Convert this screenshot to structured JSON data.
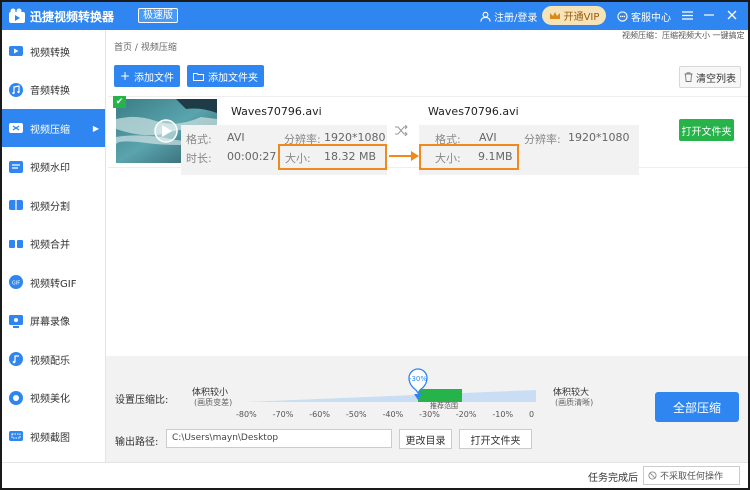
{
  "app": {
    "title": "迅捷视频转换器",
    "edition": "极速版",
    "login": "注册/登录",
    "vip": "开通VIP",
    "service": "客服中心",
    "accent": "#2f86f0"
  },
  "sidebar": {
    "items": [
      {
        "label": "视频转换",
        "icon": "video-convert-icon"
      },
      {
        "label": "音频转换",
        "icon": "audio-convert-icon"
      },
      {
        "label": "视频压缩",
        "icon": "video-compress-icon",
        "active": true
      },
      {
        "label": "视频水印",
        "icon": "watermark-icon"
      },
      {
        "label": "视频分割",
        "icon": "split-icon"
      },
      {
        "label": "视频合并",
        "icon": "merge-icon"
      },
      {
        "label": "视频转GIF",
        "icon": "gif-icon"
      },
      {
        "label": "屏幕录像",
        "icon": "screen-record-icon"
      },
      {
        "label": "视频配乐",
        "icon": "music-icon"
      },
      {
        "label": "视频美化",
        "icon": "beautify-icon"
      },
      {
        "label": "视频截图",
        "icon": "screenshot-icon"
      }
    ]
  },
  "breadcrumb": {
    "home": "首页",
    "sep": "/",
    "current": "视频压缩"
  },
  "hint": "视频压缩：压缩视频大小 一键搞定",
  "toolbar": {
    "add_file": "添加文件",
    "add_folder": "添加文件夹",
    "clear_list": "清空列表"
  },
  "file": {
    "source": {
      "name": "Waves70796.avi",
      "format_label": "格式:",
      "format": "AVI",
      "res_label": "分辨率:",
      "resolution": "1920*1080",
      "dur_label": "时长:",
      "duration": "00:00:27",
      "size_label": "大小:",
      "size": "18.32 MB"
    },
    "target": {
      "name": "Waves70796.avi",
      "format_label": "格式:",
      "format": "AVI",
      "res_label": "分辨率:",
      "resolution": "1920*1080",
      "size_label": "大小:",
      "size": "9.1MB"
    },
    "open_folder": "打开文件夹"
  },
  "compression": {
    "label": "设置压缩比:",
    "left_title": "体积较小",
    "left_sub": "(画质变差)",
    "right_title": "体积较大",
    "right_sub": "(画质清晰)",
    "ticks": [
      "-80%",
      "-70%",
      "-60%",
      "-50%",
      "-40%",
      "-30%",
      "-20%",
      "-10%",
      "0"
    ],
    "current": "-30%",
    "current_value": -30,
    "recommended": "推荐范围"
  },
  "output": {
    "label": "输出路径:",
    "path": "C:\\Users\\mayn\\Desktop",
    "change_dir": "更改目录",
    "open_folder": "打开文件夹"
  },
  "compress_all": "全部压缩",
  "status": {
    "label": "任务完成后",
    "option": "不采取任何操作"
  }
}
